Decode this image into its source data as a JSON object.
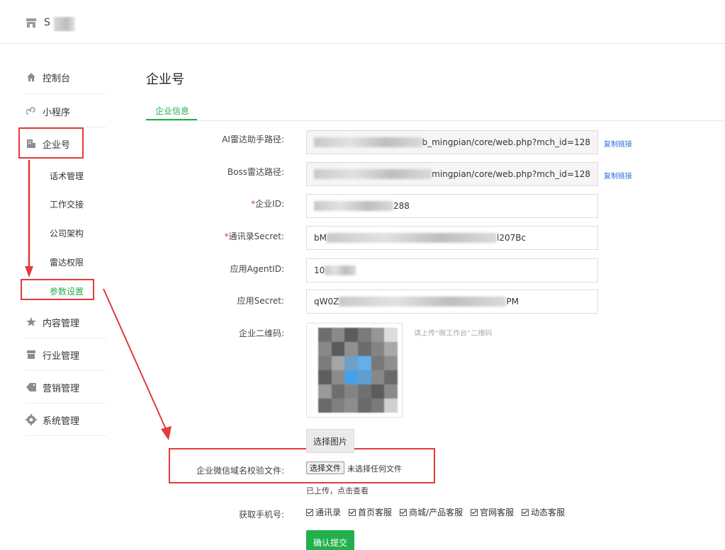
{
  "header": {
    "brand_char": "S"
  },
  "sidebar": {
    "items": [
      {
        "label": "控制台",
        "icon": "home-icon"
      },
      {
        "label": "小程序",
        "icon": "miniprogram-icon"
      },
      {
        "label": "企业号",
        "icon": "building-icon"
      },
      {
        "label": "内容管理",
        "icon": "star-icon"
      },
      {
        "label": "行业管理",
        "icon": "store-icon"
      },
      {
        "label": "营销管理",
        "icon": "tag-icon"
      },
      {
        "label": "系统管理",
        "icon": "gear-icon"
      }
    ],
    "sub_items": [
      "话术管理",
      "工作交接",
      "公司架构",
      "雷达权限",
      "参数设置"
    ]
  },
  "main": {
    "title": "企业号",
    "tab": "企业信息",
    "fields": {
      "ai_radar_label": "AI雷达助手路径:",
      "ai_radar_value_end": "b_mingpian/core/web.php?mch_id=128",
      "boss_radar_label": "Boss雷达路径:",
      "boss_radar_value_end": "mingpian/core/web.php?mch_id=128",
      "copy_link": "复制链接",
      "corp_id_label": "企业ID:",
      "corp_id_value_end": "288",
      "contact_secret_label": "通讯录Secret:",
      "contact_secret_start": "bM",
      "contact_secret_end": "l207Bc",
      "agent_id_label": "应用AgentID:",
      "agent_id_start": "10",
      "app_secret_label": "应用Secret:",
      "app_secret_start": "qW0Z",
      "app_secret_end": "PM",
      "qr_label": "企业二维码:",
      "qr_hint": "请上传“微工作台”二维码",
      "select_image": "选择图片",
      "domain_file_label": "企业微信域名校验文件:",
      "choose_file": "选择文件",
      "no_file": "未选择任何文件",
      "uploaded": "已上传，点击查看",
      "phone_label": "获取手机号:",
      "phone_options": [
        "通讯录",
        "首页客服",
        "商城/产品客服",
        "官网客服",
        "动态客服"
      ],
      "submit": "确认提交"
    }
  },
  "colors": {
    "accent": "#21b04b",
    "highlight": "#e33b3b",
    "link": "#2a6fd6"
  }
}
